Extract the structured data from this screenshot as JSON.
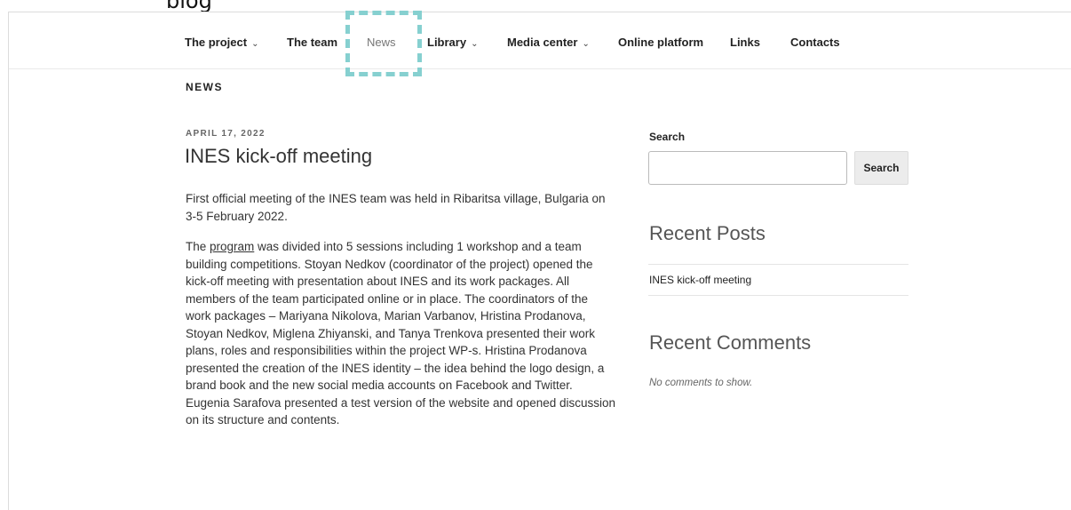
{
  "caption": "blog",
  "nav": {
    "items": [
      {
        "label": "The project",
        "chevron": "⌄",
        "name": "nav-item-the-project"
      },
      {
        "label": "The team",
        "name": "nav-item-the-team"
      },
      {
        "label": "News",
        "name": "nav-item-news",
        "current": true
      },
      {
        "label": "Library",
        "chevron": "⌄",
        "name": "nav-item-library"
      },
      {
        "label": "Media center",
        "chevron": "⌄",
        "name": "nav-item-media-center"
      },
      {
        "label": "Online platform",
        "name": "nav-item-online-platform"
      },
      {
        "label": "Links",
        "name": "nav-item-links"
      },
      {
        "label": "Contacts",
        "name": "nav-item-contacts"
      }
    ]
  },
  "page": {
    "section_title": "NEWS"
  },
  "post": {
    "date": "APRIL 17, 2022",
    "title": "INES kick-off meeting",
    "para1": "First official meeting of the INES team was held in Ribaritsa village, Bulgaria on 3-5 February 2022.",
    "para2_prefix": "The ",
    "para2_link": "program",
    "para2_rest": " was divided into 5 sessions  including 1 workshop and a team building competitions. Stoyan Nedkov (coordinator of the project) opened the kick-off meeting with presentation about INES and its work packages. All members of the team participated online or in place. The coordinators of the work packages – Mariyana Nikolova, Marian Varbanov, Hristina Prodanova, Stoyan Nedkov, Miglena Zhiyanski, and Tanya Trenkova presented their work plans, roles and responsibilities within the project WP-s. Hristina Prodanova presented the creation of the INES identity – the idea behind the logo design, a brand book and the new social media accounts on Facebook and Twitter. Eugenia Sarafova presented a test version of the website and opened discussion on its structure and contents."
  },
  "sidebar": {
    "search_label": "Search",
    "search_value": "",
    "search_button": "Search",
    "recent_posts_title": "Recent Posts",
    "recent_posts": [
      "INES kick-off meeting"
    ],
    "recent_comments_title": "Recent Comments",
    "no_comments": "No comments to show."
  },
  "colors": {
    "highlight": "#86d0d0"
  }
}
